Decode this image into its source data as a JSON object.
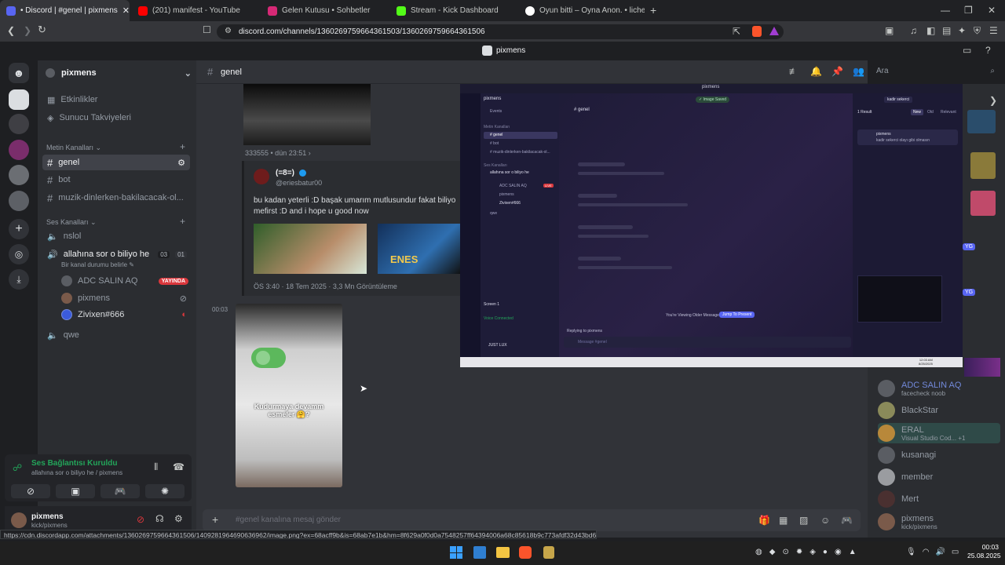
{
  "browser": {
    "tabs": [
      {
        "title": "• Discord | #genel | pixmens",
        "active": true,
        "color": "#5865f2"
      },
      {
        "title": "(201) manifest - YouTube",
        "active": false,
        "color": "#ff0000"
      },
      {
        "title": "Gelen Kutusu • Sohbetler",
        "active": false,
        "color": "#d62976"
      },
      {
        "title": "Stream - Kick Dashboard",
        "active": false,
        "color": "#53fc18"
      },
      {
        "title": "Oyun bitti – Oyna Anon. • lichess.org",
        "active": false,
        "color": "#ffffff"
      }
    ],
    "url": "discord.com/channels/1360269759664361503/1360269759664361506",
    "status_url": "https://cdn.discordapp.com/attachments/1360269759664361506/1409281964690636962/image.png?ex=68acff9b&is=68ab7e1b&hm=8f629a0f0d0a7548257ff64394006a68c85618b9c773afdf32d43bd60d403e885&"
  },
  "discord": {
    "window_title": "pixmens",
    "server_name": "pixmens",
    "channel_title": "genel",
    "search_placeholder": "Ara",
    "top_links": [
      "Etkinlikler",
      "Sunucu Takviyeleri"
    ],
    "text_category": "Metin Kanalları",
    "text_channels": [
      "genel",
      "bot",
      "muzik-dinlerken-bakilacacak-ol..."
    ],
    "voice_category": "Ses Kanalları",
    "voice_channels": [
      {
        "name": "nslol"
      },
      {
        "name": "allahına sor o biliyo he",
        "count": "03",
        "limit": "01",
        "status": "Bir kanal durumu belirle"
      },
      {
        "name": "qwe"
      }
    ],
    "voice_members": [
      {
        "name": "ADC SALIN AQ",
        "badge": "YAYINDA"
      },
      {
        "name": "pixmens"
      },
      {
        "name": "Zivixen#666"
      }
    ],
    "voice_panel": {
      "title": "Ses Bağlantısı Kuruldu",
      "subtitle": "allahına sor o biliyo he / pixmens"
    },
    "user": {
      "name": "pixmens",
      "sub": "kick/pixmens"
    },
    "message_placeholder": "#genel kanalına mesaj gönder",
    "messages": {
      "reply_author": "333555 • dün 23:51 ›",
      "quote_name": "(=8=)",
      "quote_handle": "@eriesbatur00",
      "quote_text": "bu kadan yeterli :D başak umarım mutlusundur fakat biliyo mefirst :D  and i hope u good now",
      "quote_meta": "ÖS 3:40 · 18 Tem 2025 · 3,3 Mn Görüntüleme",
      "img_caption": "Kudurmaya devamm esmeler 🤗?",
      "timestamp": "00:03",
      "thumb_caption": "ENES"
    },
    "members": [
      {
        "name": "ADC SALIN AQ",
        "sub": "facecheck noob",
        "color": "#7289da"
      },
      {
        "name": "BlackStar",
        "sub": "",
        "color": "#949ba4"
      },
      {
        "name": "ERAL",
        "sub": "Visual Studio Cod...  +1",
        "color": "#949ba4"
      },
      {
        "name": "kusanagi",
        "sub": "",
        "color": "#949ba4"
      },
      {
        "name": "member",
        "sub": "",
        "color": "#949ba4"
      },
      {
        "name": "Mert",
        "sub": "",
        "color": "#949ba4"
      },
      {
        "name": "pixmens",
        "sub": "kick/pixmens",
        "color": "#949ba4"
      }
    ]
  },
  "shared_screen": {
    "server": "pixmens",
    "channel": "genel",
    "events": "Events",
    "text_cat": "Metin Kanalları",
    "channels": [
      "genel",
      "bot",
      "muzik-dinlerken-bakilacacak-ol..."
    ],
    "voice_cat": "Ses Kanalları",
    "voice": "allahına sor o biliyo he",
    "members": [
      "ADC SALIN AQ",
      "pixmens",
      "Zivixen#666"
    ],
    "qwe": "qwe",
    "live": "LIVE",
    "saved": "✓ Image Saved",
    "result": "1 Result",
    "tabs": [
      "New",
      "Old",
      "Relevant"
    ],
    "search_tag": "kadir sekerci",
    "result_author": "pixmens",
    "result_text": "kadir sekerci olayı gibi olmasın",
    "older_msg": "You're Viewing Older Messages",
    "jump": "Jump To Present",
    "reply_to": "Replying to pixmens",
    "msg_ph": "Message #genel",
    "user": "JUST LUX",
    "voice_conn": "Voice Connected",
    "screen": "Screen 1",
    "clock": "12:03 AM",
    "date": "8/25/2025"
  },
  "taskbar": {
    "time": "00:03",
    "date": "25.08.2025"
  }
}
